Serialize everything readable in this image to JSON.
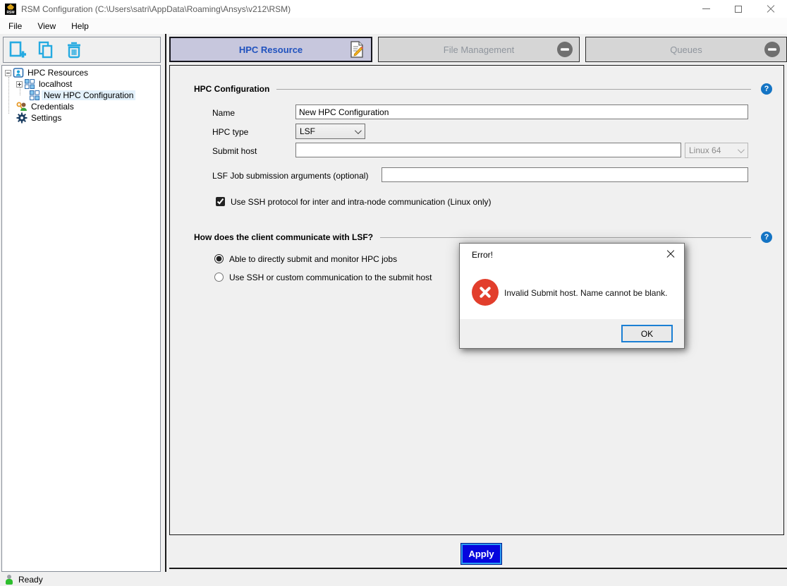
{
  "window": {
    "title": "RSM Configuration (C:\\Users\\satri\\AppData\\Roaming\\Ansys\\v212\\RSM)",
    "logo_text": "RSM"
  },
  "menu": {
    "items": [
      "File",
      "View",
      "Help"
    ]
  },
  "toolbar": {
    "buttons": [
      {
        "name": "add-configuration"
      },
      {
        "name": "duplicate-configuration"
      },
      {
        "name": "delete-configuration"
      }
    ]
  },
  "tree": {
    "items": [
      {
        "label": "HPC Resources"
      },
      {
        "label": "localhost"
      },
      {
        "label": "New HPC Configuration",
        "selected": true
      },
      {
        "label": "Credentials"
      },
      {
        "label": "Settings"
      }
    ]
  },
  "tabs": [
    {
      "label": "HPC Resource",
      "active": true
    },
    {
      "label": "File Management",
      "active": false
    },
    {
      "label": "Queues",
      "active": false
    }
  ],
  "form": {
    "section1_title": "HPC Configuration",
    "name_label": "Name",
    "name_value": "New HPC Configuration",
    "hpc_type_label": "HPC type",
    "hpc_type_value": "LSF",
    "submit_host_label": "Submit host",
    "submit_host_value": "",
    "platform_value": "Linux 64",
    "lsf_args_label": "LSF Job submission arguments (optional)",
    "lsf_args_value": "",
    "ssh_checkbox_label": "Use SSH protocol for inter and intra-node communication (Linux only)",
    "ssh_checkbox_checked": true,
    "section2_title": "How does the client communicate with LSF?",
    "radio_direct_label": "Able to directly submit and monitor HPC jobs",
    "radio_direct_checked": true,
    "radio_ssh_label": "Use SSH or custom communication to the submit host",
    "radio_ssh_checked": false,
    "apply_label": "Apply"
  },
  "dialog": {
    "title": "Error!",
    "message": "Invalid Submit host. Name cannot be blank.",
    "ok_label": "OK"
  },
  "statusbar": {
    "text": "Ready"
  },
  "icons": {
    "help_glyph": "?"
  },
  "colors": {
    "active_tab_bg": "#c7c7dd",
    "active_tab_text": "#2052be",
    "toolbar_icon": "#25aae1",
    "apply_bg": "#0505dd",
    "error_red": "#e23e2c",
    "help_blue": "#1474c4",
    "status_green": "#2dbe2d"
  }
}
